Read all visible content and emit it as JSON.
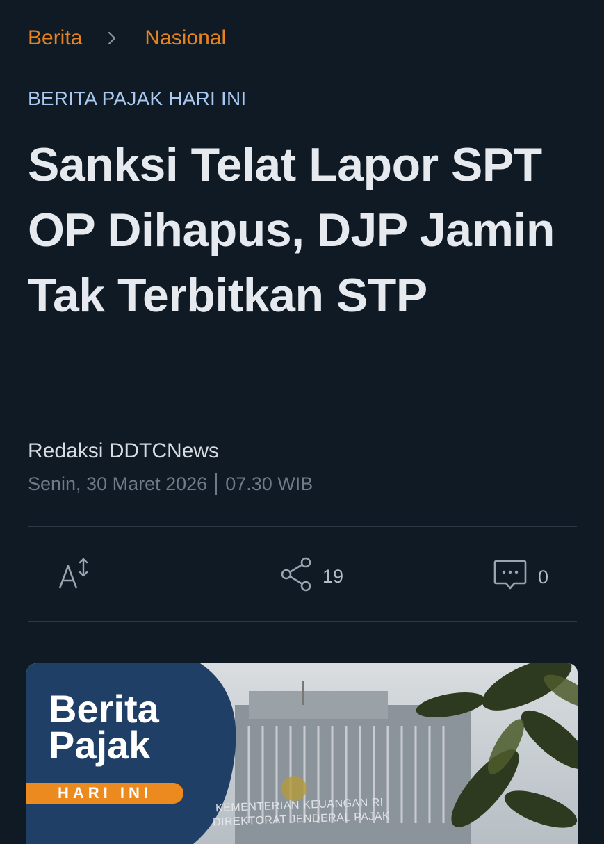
{
  "breadcrumb": {
    "items": [
      "Berita",
      "Nasional"
    ]
  },
  "article": {
    "category": "BERITA PAJAK HARI INI",
    "title": "Sanksi Telat Lapor SPT OP Dihapus, DJP Jamin Tak Terbitkan STP",
    "author": "Redaksi DDTCNews",
    "date": "Senin, 30 Maret 2026",
    "time": "07.30 WIB"
  },
  "toolbar": {
    "font_size_icon": "font-size-icon",
    "share_icon": "share-icon",
    "share_count": "19",
    "comment_icon": "comment-icon",
    "comment_count": "0"
  },
  "hero": {
    "line1": "Berita",
    "line2": "Pajak",
    "badge": "HARI INI",
    "sign1": "KEMENTERIAN KEUANGAN RI",
    "sign2": "DIREKTORAT JENDERAL PAJAK"
  },
  "colors": {
    "background": "#0f1a24",
    "accent": "#e8821e",
    "category": "#a9c9f1",
    "hero_panel": "#1f3f66"
  }
}
